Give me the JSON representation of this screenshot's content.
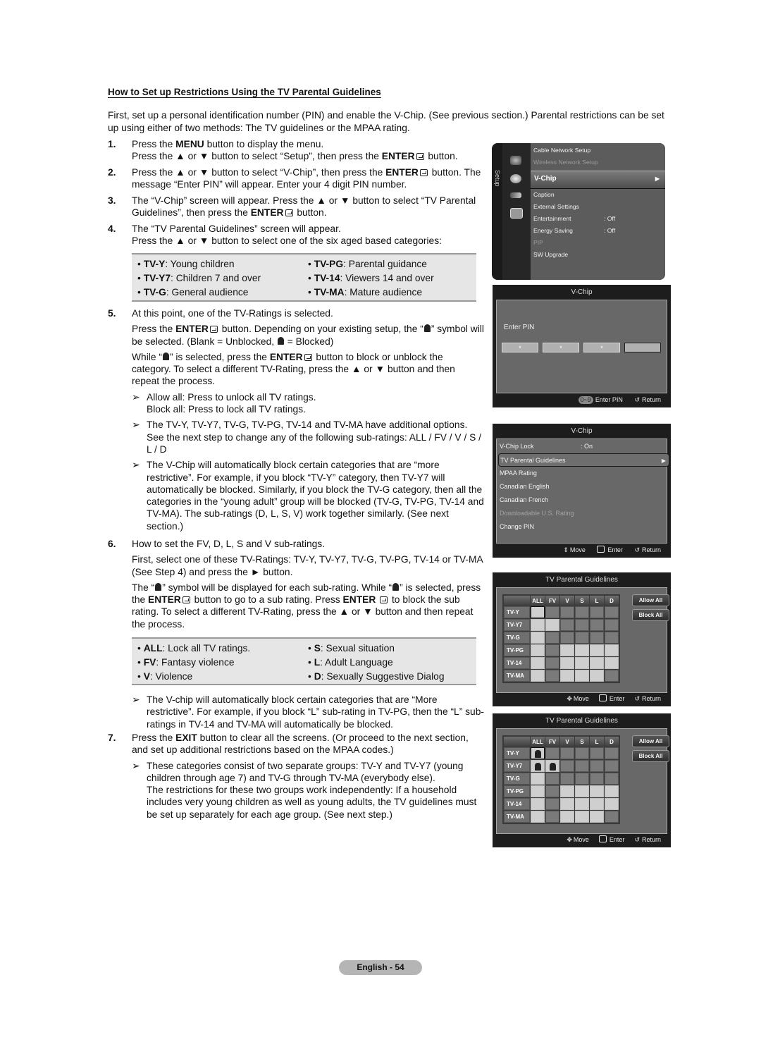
{
  "heading": "How to Set up Restrictions Using the TV Parental Guidelines",
  "intro": "First, set up a personal identification number (PIN) and enable the V-Chip. (See previous section.) Parental restrictions can be set up using either of two methods: The TV guidelines or the MPAA rating.",
  "steps": {
    "s1": {
      "num": "1.",
      "a": "Press the ",
      "a_b": "MENU",
      "a2": " button to display the menu.",
      "b": "Press the ▲ or ▼ button to select “Setup”, then press the ",
      "b_b": "ENTER",
      "b2": " button."
    },
    "s2": {
      "num": "2.",
      "a": "Press the ▲ or ▼ button to select “V-Chip”, then press the ",
      "a_b": "ENTER",
      "a2": " button. The message “Enter PIN” will appear. Enter your 4 digit PIN number."
    },
    "s3": {
      "num": "3.",
      "a": "The “V-Chip” screen will appear. Press the ▲ or ▼ button to select “TV Parental Guidelines”, then press the ",
      "a_b": "ENTER",
      "a2": " button."
    },
    "s4": {
      "num": "4.",
      "a": "The “TV Parental Guidelines” screen will appear.",
      "b": "Press the ▲ or ▼ button to select one of the six aged based categories:"
    },
    "s5": {
      "num": "5.",
      "a": "At this point, one of the TV-Ratings is selected.",
      "b1": "Press the ",
      "b_b": "ENTER",
      "b2": " button. Depending on your existing setup, the “",
      "b3": "” symbol will be selected. (Blank = Unblocked, ",
      "b4": " = Blocked)",
      "c1": "While “",
      "c2": "” is selected, press the ",
      "c_b": "ENTER",
      "c3": " button to block or unblock the category. To select a different TV-Rating, press the ▲ or ▼ button and then repeat the process.",
      "notes": [
        "Allow all: Press to unlock all TV ratings.\nBlock all: Press to lock all TV ratings.",
        "The TV-Y, TV-Y7, TV-G, TV-PG, TV-14 and TV-MA have additional options. See the next step to change any of the following sub-ratings: ALL / FV / V / S / L / D",
        "The V-Chip will automatically block certain categories that are “more restrictive”. For example, if you block “TV-Y” category, then TV-Y7 will automatically be blocked. Similarly, if you block the TV-G category, then all the categories in the “young adult” group will be blocked (TV-G, TV-PG, TV-14 and TV-MA). The sub-ratings (D, L, S, V) work together similarly. (See next section.)"
      ]
    },
    "s6": {
      "num": "6.",
      "a": "How to set the FV, D, L, S and V sub-ratings.",
      "b": "First, select one of these TV-Ratings: TV-Y, TV-Y7, TV-G, TV-PG, TV-14 or TV-MA (See Step 4) and press the ► button.",
      "c1": "The “",
      "c2": "” symbol will be displayed for each sub-rating. While “",
      "c3": "” is selected, press the ",
      "c_b": "ENTER",
      "c4": " button to go to a sub rating. Press ",
      "c_b2": "ENTER",
      "c5": " to block the sub rating. To select a different TV-Rating, press the ▲ or ▼ button and then repeat the process.",
      "note": "The V-chip will automatically block certain categories that are “More restrictive”. For example, if you block “L” sub-rating in TV-PG, then the “L” sub-ratings in TV-14 and TV-MA will automatically be blocked."
    },
    "s7": {
      "num": "7.",
      "a1": "Press the ",
      "a_b": "EXIT",
      "a2": " button to clear all the screens. (Or proceed to the next section, and set up additional restrictions based on the MPAA codes.)",
      "note": "These categories consist of two separate groups: TV-Y and TV-Y7 (young children through age 7) and TV-G through TV-MA (everybody else).\nThe restrictions for these two groups work independently: If a household includes very young children as well as young adults, the TV guidelines must be set up separately for each age group. (See next step.)"
    }
  },
  "categories": [
    {
      "code": "TV-Y",
      "desc": ": Young children"
    },
    {
      "code": "TV-Y7",
      "desc": ": Children 7 and over"
    },
    {
      "code": "TV-G",
      "desc": ": General audience"
    },
    {
      "code": "TV-PG",
      "desc": ": Parental guidance"
    },
    {
      "code": "TV-14",
      "desc": ": Viewers 14 and over"
    },
    {
      "code": "TV-MA",
      "desc": ": Mature audience"
    }
  ],
  "subratings": [
    {
      "code": "ALL",
      "desc": ": Lock all TV ratings."
    },
    {
      "code": "FV",
      "desc": ": Fantasy violence"
    },
    {
      "code": "V",
      "desc": ": Violence"
    },
    {
      "code": "S",
      "desc": ": Sexual situation"
    },
    {
      "code": "L",
      "desc": ": Adult Language"
    },
    {
      "code": "D",
      "desc": ": Sexually Suggestive Dialog"
    }
  ],
  "note_arrow": "➢",
  "bullet": "•",
  "setup_menu": {
    "side_label": "Setup",
    "items": [
      {
        "label": "Cable Network Setup",
        "value": "",
        "dim": false
      },
      {
        "label": "Wireless Network Setup",
        "value": "",
        "dim": true
      },
      {
        "label": "V-Chip",
        "value": "",
        "selected": true
      },
      {
        "label": "Caption",
        "value": ""
      },
      {
        "label": "External Settings",
        "value": ""
      },
      {
        "label": "Entertainment",
        "value": ": Off"
      },
      {
        "label": "Energy Saving",
        "value": ": Off"
      },
      {
        "label": "PIP",
        "value": "",
        "dim": true
      },
      {
        "label": "SW Upgrade",
        "value": ""
      }
    ],
    "arrow": "▶"
  },
  "pin_screen": {
    "title": "V-Chip",
    "label": "Enter PIN",
    "digits": [
      "*",
      "*",
      "*",
      ""
    ],
    "footer": {
      "digits_badge": "0~9",
      "enter_pin": "Enter PIN",
      "return": "Return",
      "return_icon": "↺"
    }
  },
  "vchip_screen": {
    "title": "V-Chip",
    "items": [
      {
        "label": "V-Chip Lock",
        "value": ": On"
      },
      {
        "label": "TV Parental Guidelines",
        "value": "",
        "selected": true
      },
      {
        "label": "MPAA Rating",
        "value": ""
      },
      {
        "label": "Canadian English",
        "value": ""
      },
      {
        "label": "Canadian French",
        "value": ""
      },
      {
        "label": "Downloadable U.S. Rating",
        "value": "",
        "dim": true
      },
      {
        "label": "Change PIN",
        "value": ""
      }
    ],
    "footer": {
      "move_icon": "⇕",
      "move": "Move",
      "enter": "Enter",
      "return": "Return",
      "return_icon": "↺"
    }
  },
  "guidelines_screens": [
    {
      "title": "TV Parental Guidelines",
      "columns": [
        "ALL",
        "FV",
        "V",
        "S",
        "L",
        "D"
      ],
      "rows": [
        "TV-Y",
        "TV-Y7",
        "TV-G",
        "TV-PG",
        "TV-14",
        "TV-MA"
      ],
      "available": [
        [
          1,
          0,
          0,
          0,
          0,
          0
        ],
        [
          1,
          1,
          0,
          0,
          0,
          0
        ],
        [
          1,
          0,
          0,
          0,
          0,
          0
        ],
        [
          1,
          0,
          1,
          1,
          1,
          1
        ],
        [
          1,
          0,
          1,
          1,
          1,
          1
        ],
        [
          1,
          0,
          1,
          1,
          1,
          0
        ]
      ],
      "locked": [
        [
          0,
          0,
          0,
          0,
          0,
          0
        ],
        [
          0,
          0,
          0,
          0,
          0,
          0
        ],
        [
          0,
          0,
          0,
          0,
          0,
          0
        ],
        [
          0,
          0,
          0,
          0,
          0,
          0
        ],
        [
          0,
          0,
          0,
          0,
          0,
          0
        ],
        [
          0,
          0,
          0,
          0,
          0,
          0
        ]
      ],
      "cursor": [
        0,
        0
      ],
      "allow_all": "Allow All",
      "block_all": "Block All",
      "footer": {
        "move_icon": "✥",
        "move": "Move",
        "enter": "Enter",
        "return": "Return",
        "return_icon": "↺"
      }
    },
    {
      "title": "TV Parental Guidelines",
      "columns": [
        "ALL",
        "FV",
        "V",
        "S",
        "L",
        "D"
      ],
      "rows": [
        "TV-Y",
        "TV-Y7",
        "TV-G",
        "TV-PG",
        "TV-14",
        "TV-MA"
      ],
      "available": [
        [
          1,
          0,
          0,
          0,
          0,
          0
        ],
        [
          1,
          1,
          0,
          0,
          0,
          0
        ],
        [
          1,
          0,
          0,
          0,
          0,
          0
        ],
        [
          1,
          0,
          1,
          1,
          1,
          1
        ],
        [
          1,
          0,
          1,
          1,
          1,
          1
        ],
        [
          1,
          0,
          1,
          1,
          1,
          0
        ]
      ],
      "locked": [
        [
          1,
          0,
          0,
          0,
          0,
          0
        ],
        [
          1,
          1,
          0,
          0,
          0,
          0
        ],
        [
          0,
          0,
          0,
          0,
          0,
          0
        ],
        [
          0,
          0,
          0,
          0,
          0,
          0
        ],
        [
          0,
          0,
          0,
          0,
          0,
          0
        ],
        [
          0,
          0,
          0,
          0,
          0,
          0
        ]
      ],
      "cursor": [
        0,
        0
      ],
      "allow_all": "Allow All",
      "block_all": "Block All",
      "footer": {
        "move_icon": "✥",
        "move": "Move",
        "enter": "Enter",
        "return": "Return",
        "return_icon": "↺"
      }
    }
  ],
  "page_number": "English - 54"
}
